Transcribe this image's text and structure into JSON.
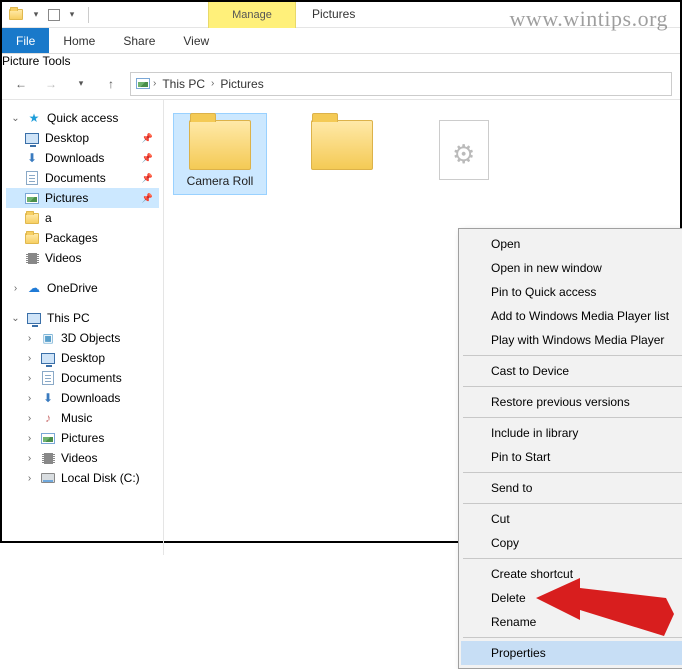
{
  "watermark": "www.wintips.org",
  "title": "Pictures",
  "qat": {
    "ctx_tab_label": "Manage",
    "ctx_tab_sub": "Picture Tools"
  },
  "ribbon": {
    "file": "File",
    "home": "Home",
    "share": "Share",
    "view": "View"
  },
  "breadcrumb": {
    "root": "This PC",
    "current": "Pictures"
  },
  "sidebar": {
    "quick_access": "Quick access",
    "qa_items": [
      {
        "label": "Desktop",
        "icon": "desktop",
        "pinned": true
      },
      {
        "label": "Downloads",
        "icon": "download",
        "pinned": true
      },
      {
        "label": "Documents",
        "icon": "doc",
        "pinned": true
      },
      {
        "label": "Pictures",
        "icon": "pic",
        "pinned": true,
        "selected": true
      },
      {
        "label": "a",
        "icon": "folder"
      },
      {
        "label": "Packages",
        "icon": "folder"
      },
      {
        "label": "Videos",
        "icon": "film"
      }
    ],
    "onedrive": "OneDrive",
    "this_pc": "This PC",
    "pc_items": [
      {
        "label": "3D Objects",
        "icon": "cube"
      },
      {
        "label": "Desktop",
        "icon": "desktop"
      },
      {
        "label": "Documents",
        "icon": "doc"
      },
      {
        "label": "Downloads",
        "icon": "download"
      },
      {
        "label": "Music",
        "icon": "music"
      },
      {
        "label": "Pictures",
        "icon": "pic"
      },
      {
        "label": "Videos",
        "icon": "film"
      },
      {
        "label": "Local Disk (C:)",
        "icon": "drive"
      }
    ]
  },
  "content": {
    "items": [
      {
        "label": "Camera Roll",
        "type": "folder",
        "selected": true
      },
      {
        "label": "",
        "type": "folder"
      },
      {
        "label": "",
        "type": "file-settings"
      }
    ]
  },
  "context_menu": {
    "groups": [
      [
        "Open",
        "Open in new window",
        "Pin to Quick access",
        "Add to Windows Media Player list",
        "Play with Windows Media Player"
      ],
      [
        {
          "label": "Cast to Device",
          "submenu": true
        }
      ],
      [
        "Restore previous versions"
      ],
      [
        {
          "label": "Include in library",
          "submenu": true
        },
        "Pin to Start"
      ],
      [
        {
          "label": "Send to",
          "submenu": true
        }
      ],
      [
        "Cut",
        "Copy"
      ],
      [
        "Create shortcut",
        "Delete",
        "Rename"
      ],
      [
        {
          "label": "Properties",
          "highlight": true
        }
      ]
    ]
  }
}
